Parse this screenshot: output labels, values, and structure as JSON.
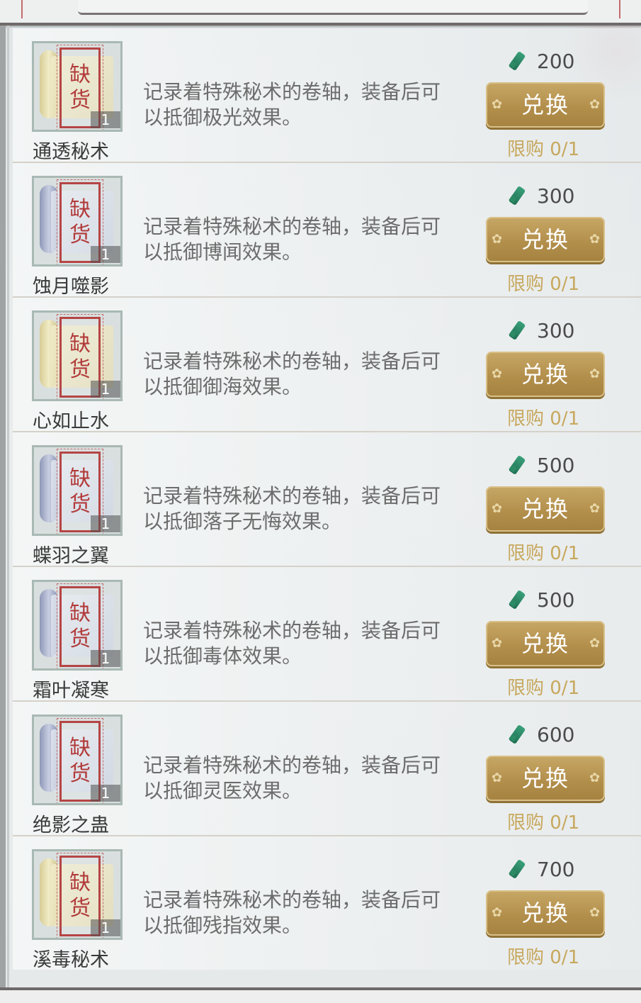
{
  "items": [
    {
      "name": "通透秘术",
      "desc_line1": "记录着特殊秘术的卷轴，装备后可",
      "desc_line2": "以抵御极光效果。",
      "price": "200",
      "button": "兑换",
      "limit": "限购 0/1",
      "stamp1": "缺",
      "stamp2": "货",
      "qty": "1",
      "tint": "yellow"
    },
    {
      "name": "蚀月噬影",
      "desc_line1": "记录着特殊秘术的卷轴，装备后可",
      "desc_line2": "以抵御博闻效果。",
      "price": "300",
      "button": "兑换",
      "limit": "限购 0/1",
      "stamp1": "缺",
      "stamp2": "货",
      "qty": "1",
      "tint": "blue"
    },
    {
      "name": "心如止水",
      "desc_line1": "记录着特殊秘术的卷轴，装备后可",
      "desc_line2": "以抵御御海效果。",
      "price": "300",
      "button": "兑换",
      "limit": "限购 0/1",
      "stamp1": "缺",
      "stamp2": "货",
      "qty": "1",
      "tint": "yellow"
    },
    {
      "name": "蝶羽之翼",
      "desc_line1": "记录着特殊秘术的卷轴，装备后可",
      "desc_line2": "以抵御落子无悔效果。",
      "price": "500",
      "button": "兑换",
      "limit": "限购 0/1",
      "stamp1": "缺",
      "stamp2": "货",
      "qty": "1",
      "tint": "blue"
    },
    {
      "name": "霜叶凝寒",
      "desc_line1": "记录着特殊秘术的卷轴，装备后可",
      "desc_line2": "以抵御毒体效果。",
      "price": "500",
      "button": "兑换",
      "limit": "限购 0/1",
      "stamp1": "缺",
      "stamp2": "货",
      "qty": "1",
      "tint": "blue"
    },
    {
      "name": "绝影之蛊",
      "desc_line1": "记录着特殊秘术的卷轴，装备后可",
      "desc_line2": "以抵御灵医效果。",
      "price": "600",
      "button": "兑换",
      "limit": "限购 0/1",
      "stamp1": "缺",
      "stamp2": "货",
      "qty": "1",
      "tint": "blue"
    },
    {
      "name": "溪毒秘术",
      "desc_line1": "记录着特殊秘术的卷轴，装备后可",
      "desc_line2": "以抵御残指效果。",
      "price": "700",
      "button": "兑换",
      "limit": "限购 0/1",
      "stamp1": "缺",
      "stamp2": "货",
      "qty": "1",
      "tint": "yellow"
    }
  ],
  "colors": {
    "button_gold": "#b38f4c",
    "limit_text": "#c7a85e",
    "stamp_red": "#b54545",
    "currency_jade": "#2c8a65"
  },
  "icons": {
    "currency": "jade-token-icon",
    "item": "scroll-icon",
    "button_deco": "flower-deco-icon"
  }
}
